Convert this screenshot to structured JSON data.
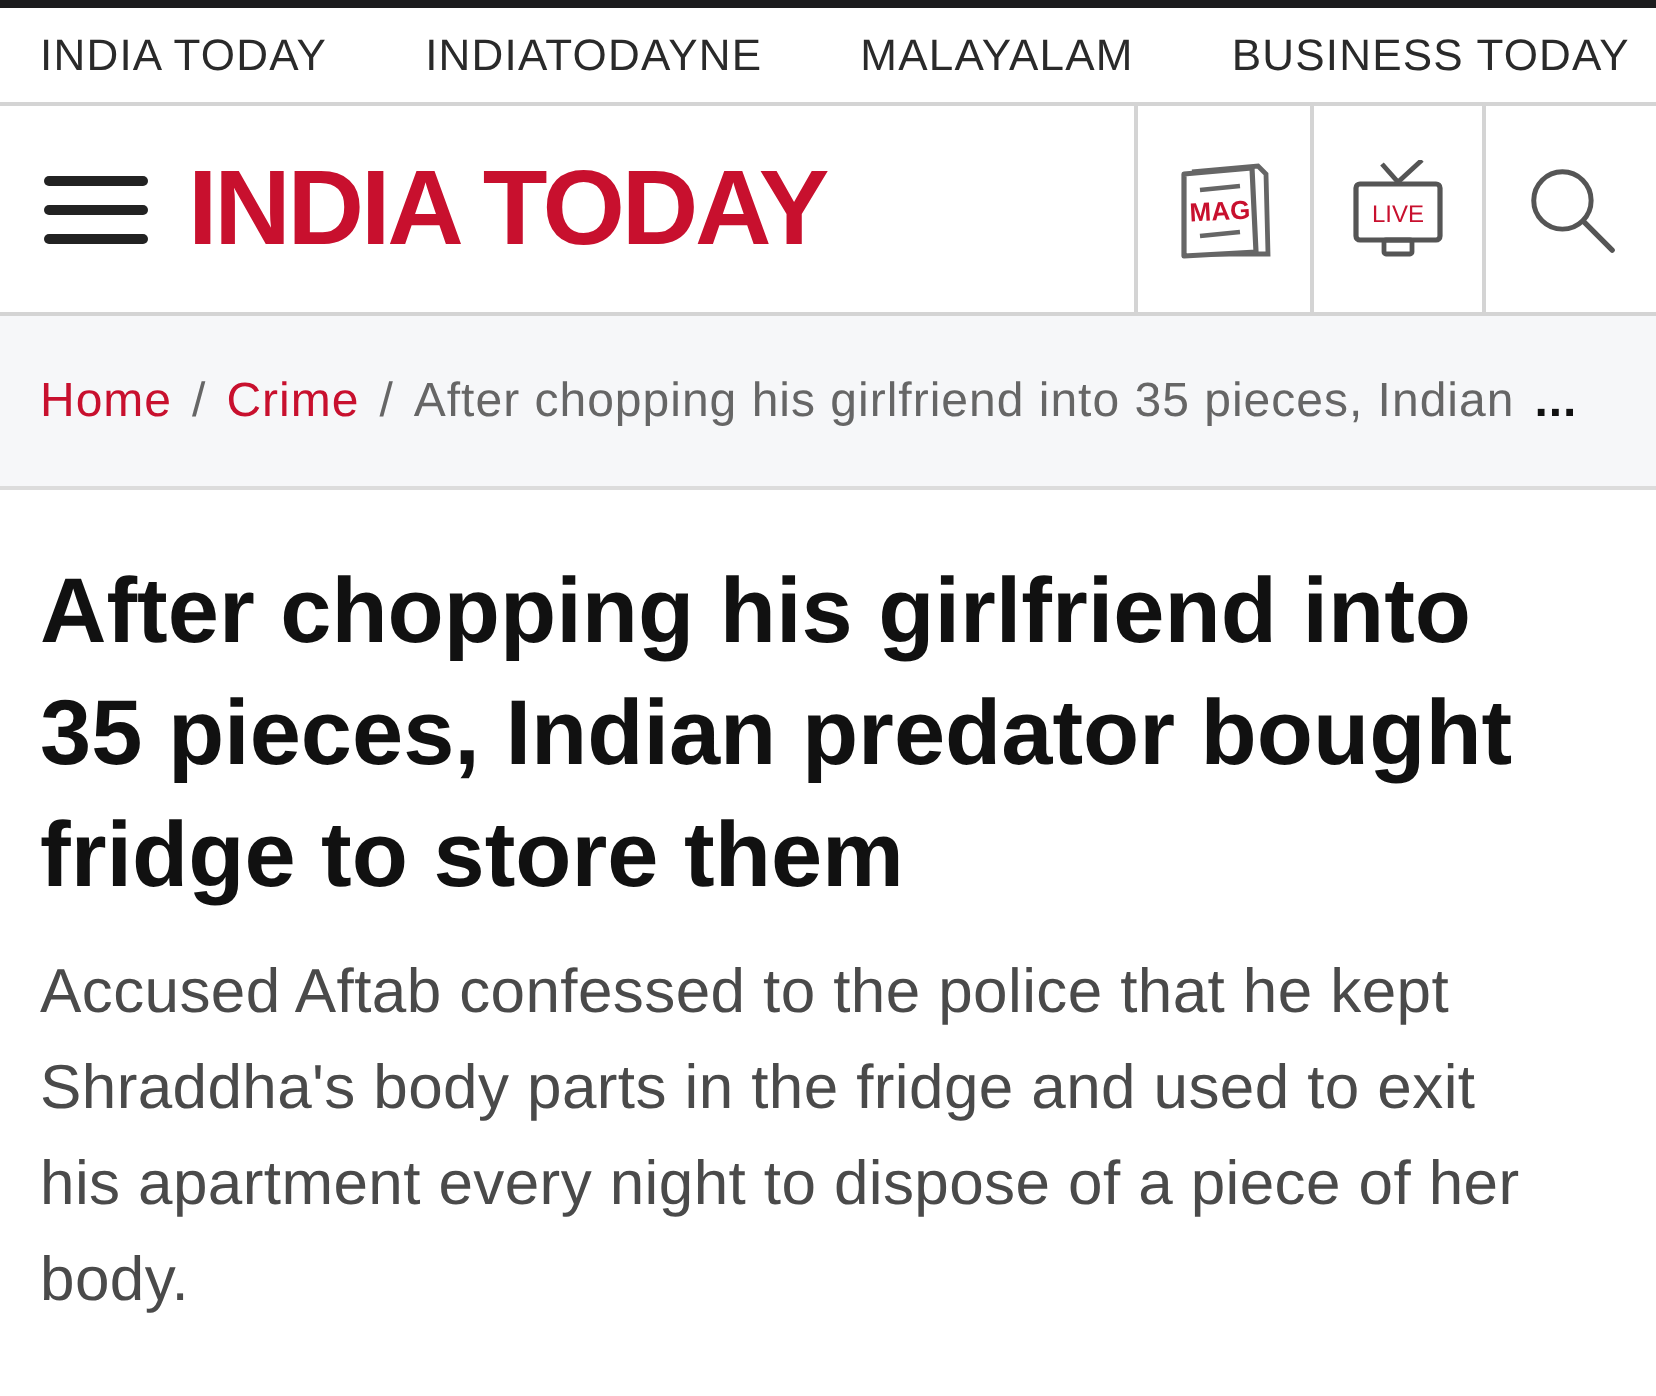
{
  "top_nav": {
    "items": [
      "INDIA TODAY",
      "INDIATODAYNE",
      "MALAYALAM",
      "BUSINESS TODAY"
    ]
  },
  "header": {
    "logo": "INDIA TODAY",
    "actions": [
      {
        "kind": "magazine",
        "label": "MAG"
      },
      {
        "kind": "live_tv",
        "label": "LIVE"
      },
      {
        "kind": "search"
      }
    ]
  },
  "breadcrumb": {
    "items": [
      {
        "label": "Home",
        "kind": "link",
        "separator": "/"
      },
      {
        "label": "Crime",
        "kind": "link",
        "separator": "/"
      },
      {
        "label": "After chopping his girlfriend into 35 pieces, Indian",
        "kind": "current"
      }
    ],
    "overflow": "..."
  },
  "article": {
    "headline": "After chopping his girlfriend into 35 pieces, Indian predator bought fridge to store them",
    "summary": "Accused Aftab confessed to the police that he kept Shraddha's body parts in the fridge and used to exit his apartment every night to dispose of a piece of her body."
  }
}
